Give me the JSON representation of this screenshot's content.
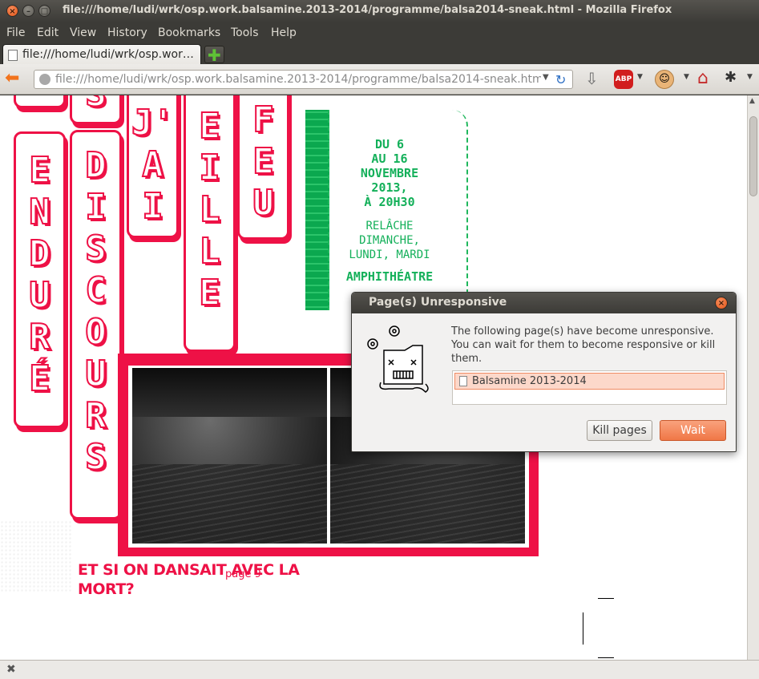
{
  "window": {
    "title": "file:///home/ludi/wrk/osp.work.balsamine.2013-2014/programme/balsa2014-sneak.html - Mozilla Firefox"
  },
  "menu": [
    "File",
    "Edit",
    "View",
    "History",
    "Bookmarks",
    "Tools",
    "Help"
  ],
  "tab": {
    "label": "file:///home/ludi/wrk/osp.wor…"
  },
  "navbar": {
    "url": "file:///home/ludi/wrk/osp.work.balsamine.2013-2014/programme/balsa2014-sneak.html",
    "abp_label": "ABP"
  },
  "content": {
    "columns": [
      {
        "top": "",
        "letters": [
          "E",
          "N",
          "D",
          "U",
          "R",
          "É"
        ]
      },
      {
        "top": "S",
        "letters": [
          "D",
          "I",
          "S",
          "C",
          "O",
          "U",
          "R",
          "S"
        ]
      },
      {
        "top": "",
        "letters": [
          "J'",
          "A",
          "I"
        ]
      },
      {
        "top": "",
        "letters": [
          "E",
          "I",
          "L",
          "L",
          "E"
        ]
      },
      {
        "top": "",
        "letters": [
          "F",
          "E",
          "U"
        ]
      }
    ],
    "dates": "DU 6\nAU 16\nNOVEMBRE\n2013,\nÀ 20H30",
    "relache": "RELÂCHE\nDIMANCHE,\nLUNDI, MARDI",
    "venue": "AMPHITHÉATRE",
    "caption": "ET SI ON DANSAIT AVEC LA MORT?",
    "page_label": "page 9"
  },
  "dialog": {
    "title": "Page(s) Unresponsive",
    "message": "The following page(s) have become unresponsive. You can wait for them to become responsive or kill them.",
    "list": [
      "Balsamine 2013-2014"
    ],
    "kill_button": "Kill pages",
    "wait_button": "Wait"
  },
  "colors": {
    "accent_pink": "#ee1146",
    "accent_green": "#14b05a",
    "ubuntu_orange": "#f07746"
  }
}
